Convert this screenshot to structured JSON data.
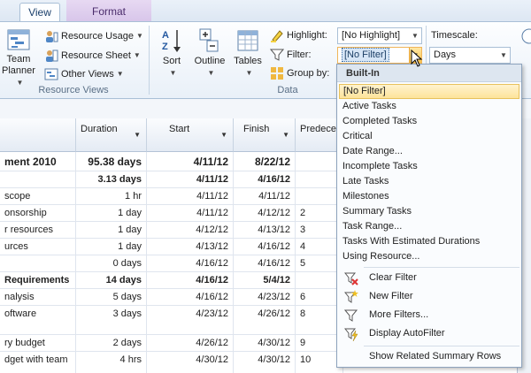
{
  "tabs": {
    "view": "View",
    "format": "Format"
  },
  "ribbon": {
    "resource_views": {
      "team_planner_line1": "Team",
      "team_planner_line2": "Planner",
      "resource_usage": "Resource Usage",
      "resource_sheet": "Resource Sheet",
      "other_views": "Other Views",
      "label": "Resource Views"
    },
    "data": {
      "sort": "Sort",
      "outline": "Outline",
      "tables": "Tables",
      "highlight_label": "Highlight:",
      "highlight_value": "[No Highlight]",
      "filter_label": "Filter:",
      "filter_value": "[No Filter]",
      "group_by_label": "Group by:",
      "label": "Data"
    },
    "timescale": {
      "label": "Timescale:",
      "value": "Days"
    }
  },
  "grid": {
    "headers": {
      "duration": "Duration",
      "start": "Start",
      "finish": "Finish",
      "predecessors": "Predeces"
    },
    "rows": [
      {
        "name": "ment 2010",
        "duration": "95.38 days",
        "start": "4/11/12",
        "finish": "8/22/12",
        "pred": "",
        "style": "big"
      },
      {
        "name": "",
        "duration": "3.13 days",
        "start": "4/11/12",
        "finish": "4/16/12",
        "pred": "",
        "style": "bold"
      },
      {
        "name": " scope",
        "duration": "1 hr",
        "start": "4/11/12",
        "finish": "4/11/12",
        "pred": "",
        "style": ""
      },
      {
        "name": "onsorship",
        "duration": "1 day",
        "start": "4/11/12",
        "finish": "4/12/12",
        "pred": "2",
        "style": ""
      },
      {
        "name": "r resources",
        "duration": "1 day",
        "start": "4/12/12",
        "finish": "4/13/12",
        "pred": "3",
        "style": ""
      },
      {
        "name": "urces",
        "duration": "1 day",
        "start": "4/13/12",
        "finish": "4/16/12",
        "pred": "4",
        "style": ""
      },
      {
        "name": "",
        "duration": "0 days",
        "start": "4/16/12",
        "finish": "4/16/12",
        "pred": "5",
        "style": ""
      },
      {
        "name": " Requirements",
        "duration": "14 days",
        "start": "4/16/12",
        "finish": "5/4/12",
        "pred": "",
        "style": "bold"
      },
      {
        "name": "nalysis",
        "duration": "5 days",
        "start": "4/16/12",
        "finish": "4/23/12",
        "pred": "6",
        "style": ""
      },
      {
        "name": "oftware",
        "duration": "3 days",
        "start": "4/23/12",
        "finish": "4/26/12",
        "pred": "8",
        "style": ""
      },
      {
        "name": "ry budget",
        "duration": "2 days",
        "start": "4/26/12",
        "finish": "4/30/12",
        "pred": "9",
        "style": ""
      },
      {
        "name": "dget with team",
        "duration": "4 hrs",
        "start": "4/30/12",
        "finish": "4/30/12",
        "pred": "10",
        "style": ""
      }
    ]
  },
  "filter_menu": {
    "heading": "Built-In",
    "items": [
      "[No Filter]",
      "Active Tasks",
      "Completed Tasks",
      "Critical",
      "Date Range...",
      "Incomplete Tasks",
      "Late Tasks",
      "Milestones",
      "Summary Tasks",
      "Task Range...",
      "Tasks With Estimated Durations",
      "Using Resource..."
    ],
    "commands": {
      "clear_filter": "Clear Filter",
      "new_filter": "New Filter",
      "more_filters": "More Filters...",
      "display_autofilter": "Display AutoFilter",
      "show_related": "Show Related Summary Rows"
    }
  },
  "colors": {
    "accent": "#f8c24a",
    "ribbon_border": "#a9bfd6",
    "format_tab": "#d8c6ea"
  }
}
